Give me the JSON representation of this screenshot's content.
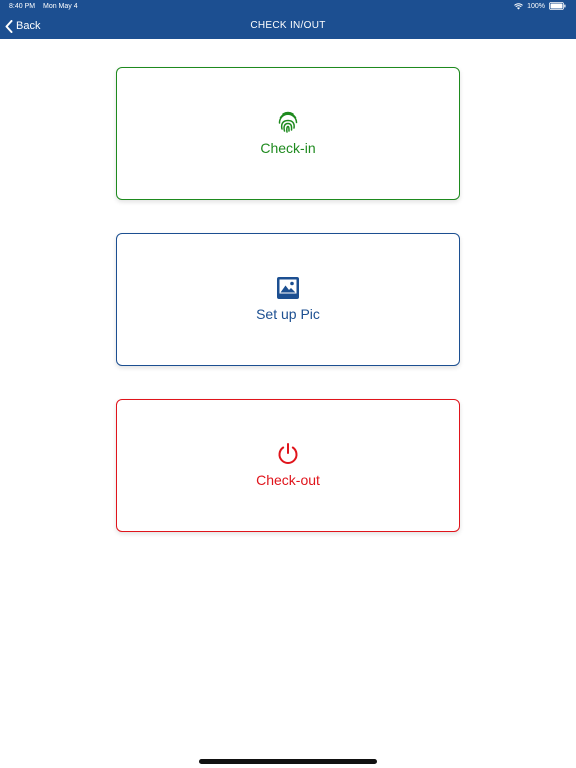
{
  "status_bar": {
    "time": "8:40 PM",
    "date": "Mon May 4",
    "battery": "100%"
  },
  "nav": {
    "back_label": "Back",
    "title": "CHECK IN/OUT"
  },
  "actions": {
    "checkin": {
      "label": "Check-in",
      "icon": "fingerprint-icon",
      "color": "#1e8a1e"
    },
    "setup_pic": {
      "label": "Set up Pic",
      "icon": "image-icon",
      "color": "#1c4f91"
    },
    "checkout": {
      "label": "Check-out",
      "icon": "power-icon",
      "color": "#e0141b"
    }
  },
  "colors": {
    "header_bg": "#1c4f91",
    "background": "#ffffff"
  }
}
